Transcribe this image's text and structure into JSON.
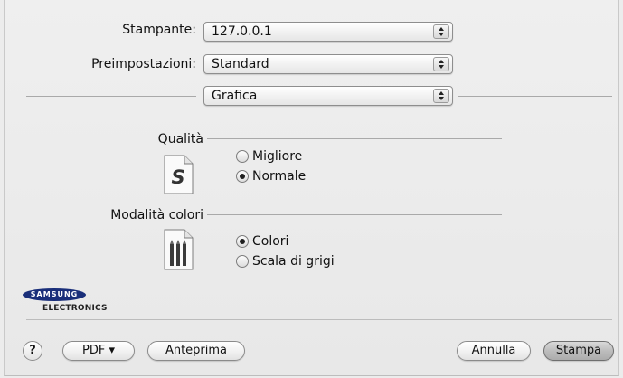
{
  "printer": {
    "label": "Stampante:",
    "value": "127.0.0.1"
  },
  "presets": {
    "label": "Preimpostazioni:",
    "value": "Standard"
  },
  "section": {
    "value": "Grafica"
  },
  "quality": {
    "title": "Qualità",
    "icon_letter": "S",
    "options": [
      {
        "label": "Migliore",
        "selected": false
      },
      {
        "label": "Normale",
        "selected": true
      }
    ]
  },
  "color_mode": {
    "title": "Modalità colori",
    "options": [
      {
        "label": "Colori",
        "selected": true
      },
      {
        "label": "Scala di grigi",
        "selected": false
      }
    ]
  },
  "brand": {
    "logo_text": "SAMSUNG",
    "sub_text": "ELECTRONICS",
    "color": "#1a2f7a"
  },
  "footer": {
    "help_label": "?",
    "pdf_label": "PDF ▾",
    "preview_label": "Anteprima",
    "cancel_label": "Annulla",
    "print_label": "Stampa"
  }
}
